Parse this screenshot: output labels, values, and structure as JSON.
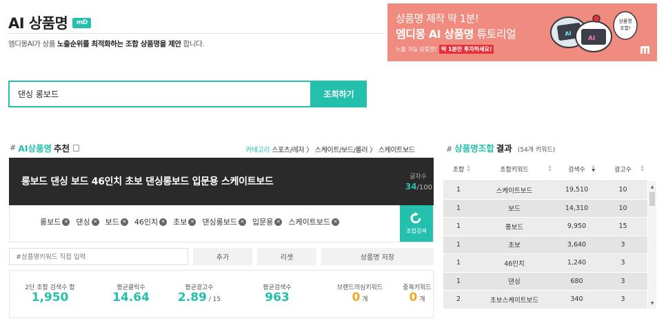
{
  "header": {
    "title": "AI 상품명",
    "badge": "mD",
    "subtitle_pre": "엠디몽AI가 상품 ",
    "subtitle_bold": "노출순위를 최적화하는 조합 상품명을 제안",
    "subtitle_post": " 합니다."
  },
  "banner": {
    "line1": "상품명 제작 딱 1분!",
    "line2_bold": "엠디몽 AI 상품명",
    "line2_rest": " 튜토리얼",
    "line3_pre": "노출 가능 상품명!",
    "line3_highlight": "딱 1분만 투자하세요!",
    "bubble_line1": "상품명",
    "bubble_line2": "조합!",
    "robot_text": "AI",
    "accent_color": "#f08b7f"
  },
  "search": {
    "value": "댄싱 롱보드",
    "button_label": "조회하기"
  },
  "left": {
    "title_hash": "#",
    "title_accent": "AI상품명",
    "title_rest": "추천",
    "breadcrumb": [
      {
        "label": "카테고리",
        "accent": true
      },
      {
        "label": "스포츠/레저",
        "accent": false
      },
      {
        "label": "〉",
        "accent": false
      },
      {
        "label": "스케이트/보드/롤러",
        "accent": false
      },
      {
        "label": "〉",
        "accent": false
      },
      {
        "label": "스케이트보드",
        "accent": false
      }
    ],
    "product_name": "롱보드 댄싱 보드 46인치 초보 댄싱롱보드 입문용 스케이트보드",
    "char_label": "글자수",
    "char_count": "34",
    "char_max": "/100",
    "chips": [
      "롱보드",
      "댄싱",
      "보드",
      "46인치",
      "초보",
      "댄싱롱보드",
      "입문용",
      "스케이트보드"
    ],
    "regen_label": "조합검색",
    "keyword_placeholder": "#상품명키워드 직접 입력",
    "buttons": {
      "add": "추가",
      "reset": "리셋",
      "save": "상품명 저장"
    },
    "stats": [
      {
        "label": "2단 조합 검색수 합",
        "value": "1,950",
        "sub": "",
        "orange": false
      },
      {
        "label": "평균클릭수",
        "value": "14.64",
        "sub": "",
        "orange": false
      },
      {
        "label": "평균광고수",
        "value": "2.89",
        "sub": " / 15",
        "orange": false
      },
      {
        "label": "평균검색수",
        "value": "963",
        "sub": "",
        "orange": false
      },
      {
        "label": "브랜드의심키워드",
        "value": "0",
        "sub": " 개",
        "orange": true
      },
      {
        "label": "중복키워드",
        "value": "0",
        "sub": " 개",
        "orange": true
      }
    ]
  },
  "right": {
    "title_hash": "#",
    "title_accent": "상품명조합",
    "title_rest": "결과",
    "count": "(54개 키워드)",
    "columns": [
      "조합",
      "조합키워드",
      "검색수",
      "광고수"
    ],
    "rows": [
      [
        "1",
        "스케이트보드",
        "19,510",
        "10"
      ],
      [
        "1",
        "보드",
        "14,310",
        "10"
      ],
      [
        "1",
        "롱보드",
        "9,950",
        "15"
      ],
      [
        "1",
        "초보",
        "3,640",
        "3"
      ],
      [
        "1",
        "46인치",
        "1,240",
        "3"
      ],
      [
        "1",
        "댄싱",
        "680",
        "3"
      ],
      [
        "2",
        "초보스케이트보드",
        "340",
        "3"
      ]
    ]
  }
}
